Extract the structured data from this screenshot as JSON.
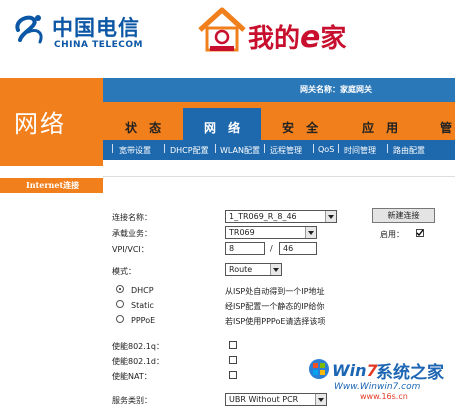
{
  "branding": {
    "telecom_cn": "中国电信",
    "telecom_en": "CHINA TELECOM",
    "ehome_prefix": "我的",
    "ehome_e": "e",
    "ehome_suffix": "家",
    "house_text": "我的e家"
  },
  "section_title": "网络",
  "gateway_name": "网关名称：家庭网关",
  "left_menu": {
    "items": [
      "Internet连接"
    ]
  },
  "tabs": [
    "状 态",
    "网 络",
    "安 全",
    "应 用",
    "管"
  ],
  "active_tab": "网 络",
  "subnav": [
    "宽带设置",
    "DHCP配置",
    "WLAN配置",
    "远程管理",
    "QoS",
    "时间管理",
    "路由配置"
  ],
  "form": {
    "conn_name_label": "连接名称：",
    "conn_name_value": "1_TR069_R_8_46",
    "service_label": "承载业务：",
    "service_value": "TR069",
    "vpi_label": "VPI/VCI：",
    "vpi_value": "8",
    "vci_value": "46",
    "vpi_sep": "/",
    "mode_label": "模式：",
    "mode_value": "Route",
    "new_conn_button": "新建连接",
    "enable_label": "启用：",
    "enable_checked": true,
    "radio_options": [
      {
        "label": "DHCP",
        "desc": "从ISP处自动得到一个IP地址",
        "selected": true
      },
      {
        "label": "Static",
        "desc": "经ISP配置一个静态的IP给你",
        "selected": false
      },
      {
        "label": "PPPoE",
        "desc": "若ISP使用PPPoE请选择该项",
        "selected": false
      }
    ],
    "dot1q_label": "使能802.1q：",
    "dot1d_label": "使能802.1d：",
    "nat_label": "使能NAT：",
    "service_class_label": "服务类别：",
    "service_class_value": "UBR Without PCR"
  },
  "watermark": {
    "brand_w": "Win",
    "brand_7": "7",
    "brand_cn": "系统之家",
    "url": "Www.Winwin7.com",
    "url2": "www.16s.cn"
  },
  "colors": {
    "orange": "#f07f1c",
    "blue": "#1e69ad",
    "telecom_blue": "#0b57a5",
    "ehome_red": "#c8102e"
  }
}
